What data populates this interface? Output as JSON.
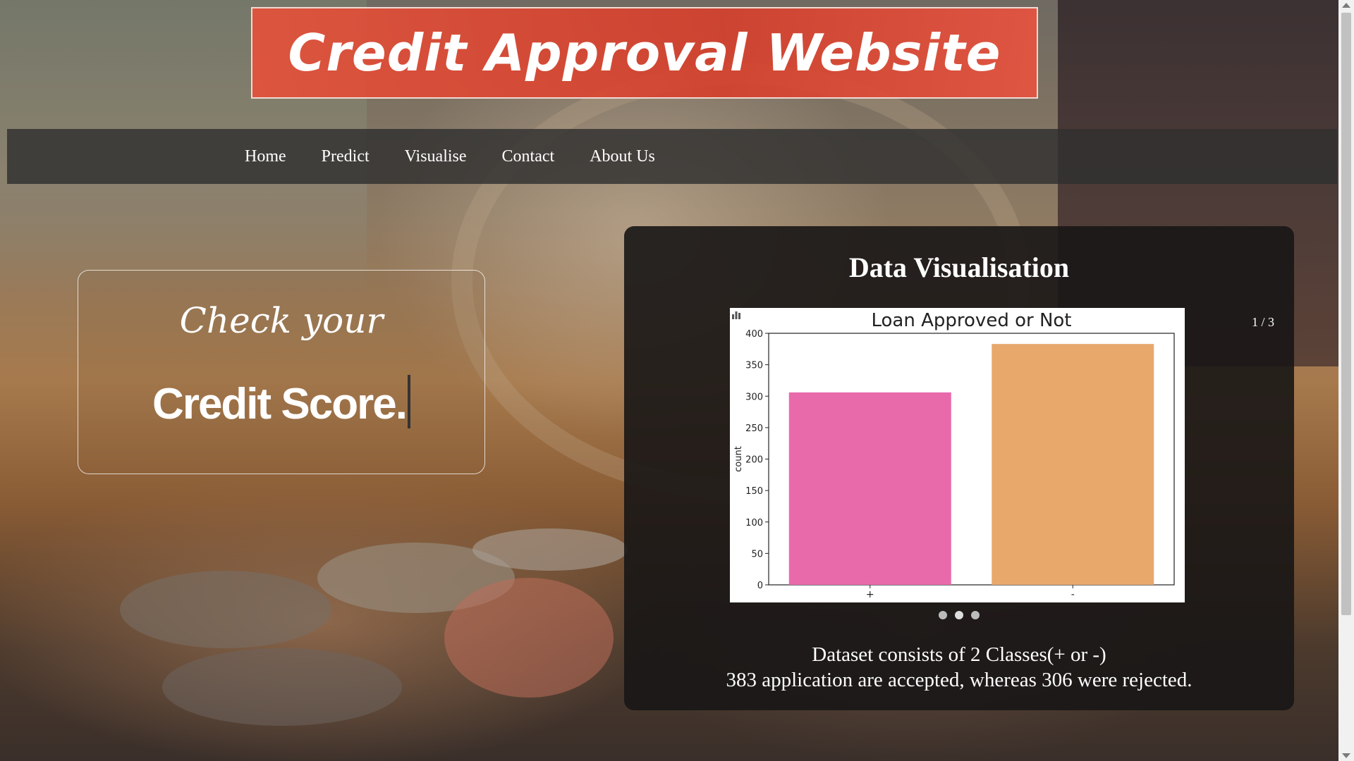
{
  "header": {
    "title": "Credit Approval Website"
  },
  "nav": {
    "items": [
      {
        "label": "Home"
      },
      {
        "label": "Predict"
      },
      {
        "label": "Visualise"
      },
      {
        "label": "Contact"
      },
      {
        "label": "About Us"
      }
    ]
  },
  "hero": {
    "line1": "Check your",
    "line2": "Credit Score."
  },
  "visualisation": {
    "title": "Data Visualisation",
    "counter": "1 / 3",
    "caption_line1": "Dataset consists of 2 Classes(+ or -)",
    "caption_line2": "383 application are accepted, whereas 306 were rejected.",
    "dots": [
      {
        "active": false
      },
      {
        "active": true
      },
      {
        "active": false
      }
    ]
  },
  "chart_data": {
    "type": "bar",
    "title": "Loan Approved or Not",
    "xlabel": "",
    "ylabel": "count",
    "categories": [
      "+",
      "-"
    ],
    "values": [
      306,
      383
    ],
    "colors": [
      "#e86aab",
      "#e8a86b"
    ],
    "ylim": [
      0,
      400
    ],
    "yticks": [
      0,
      50,
      100,
      150,
      200,
      250,
      300,
      350,
      400
    ],
    "grid": false
  }
}
